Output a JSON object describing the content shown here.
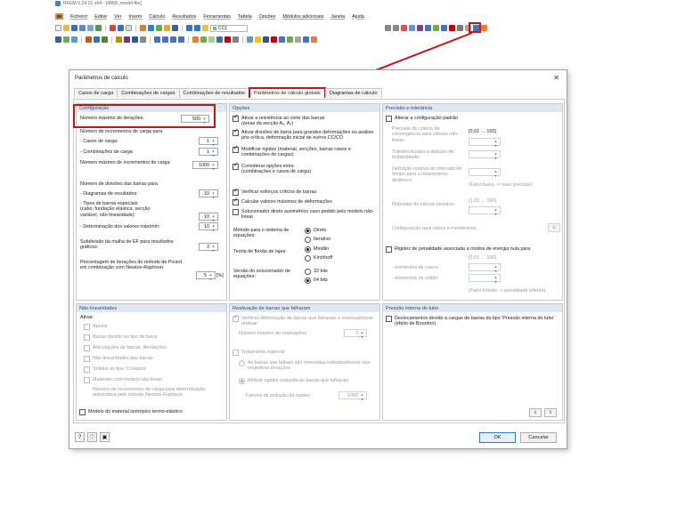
{
  "app": {
    "title": "RFEM 5.24.01 x64 - [4868_model-file]",
    "menu": [
      "Ficheiro",
      "Editar",
      "Ver",
      "Inserir",
      "Cálculo",
      "Resultados",
      "Ferramentas",
      "Tabela",
      "Opções",
      "Módulos adicionais",
      "Janela",
      "Ajuda"
    ],
    "load_case": "CC1"
  },
  "dialog": {
    "title": "Parâmetros de cálculo",
    "close": "✕",
    "tabs": [
      "Casos de carga",
      "Combinações de cargas",
      "Combinações de resultados",
      "Parâmetros de cálculo globais",
      "Diagramas de cálculo"
    ],
    "active_tab": 3
  },
  "config": {
    "header": "Configuração",
    "max_iter_label": "Número máximo de iterações:",
    "max_iter_value": "500",
    "load_increments_header": "Número de incrementos de carga para",
    "lc_label": "- Casos de carga:",
    "lc_value": "1",
    "comb_label": "- Combinações de carga",
    "comb_value": "1",
    "max_load_inc_label": "Número máximo de incrementos de carga:",
    "max_load_inc_value": "1000",
    "bar_div_header": "Número de divisões das barras para",
    "result_diag_label": "- Diagramas de resultados:",
    "result_diag_value": "10",
    "special_bars_label": "- Tipos de barras especiais\n  (cabo, fundação elástica, secção\n  variável, não-linearidade):",
    "special_bars_value": "10",
    "maxmin_label": "- Determinação dos valores máx/mín:",
    "maxmin_value": "10",
    "fe_sub_label": "Subdivisão da malha de EF para resultados gráficos:",
    "fe_sub_value": "3",
    "picard_label": "Percentagem de iterações do método de Picard em combinação com Newton-Raphson:",
    "picard_value": "5",
    "picard_unit": "[%]"
  },
  "options": {
    "header": "Opções",
    "cb1": "Ativar a resistência ao corte das barras\n(áreas da secção Aᵧ, A₂)",
    "cb2": "Ativar divisões de barra para grandes deformações ou análise pós-crítica, deformação inicial de outros CC/CO",
    "cb3": "Modificar rigidez (material, secções, barras casos e combinações de cargas)",
    "cb4": "Considerar opções extra\n(combinações e casos de carga)",
    "cb5": "Verificar esforços críticos de barras",
    "cb6": "Calcular valores máximos de deformações",
    "cb7": "Solucionador direto assimétrico caso pedido pelo modelo não-linear",
    "system_label": "Método para o sistema de equações:",
    "system_opts": [
      "Direto",
      "Iterativo"
    ],
    "plate_label": "Teoria de flexão de lajes:",
    "plate_opts": [
      "Mindlin",
      "Kirchhoff"
    ],
    "solver_label": "Versão do solucionador de equações:",
    "solver_opts": [
      "32 bits",
      "64 bits"
    ]
  },
  "precision": {
    "header": "Precisão e tolerância",
    "change_label": "Alterar a configuração padrão",
    "conv_label": "Precisão do critério de convergência para cálculo não-linear:",
    "range1": "[0,01 … 100]",
    "tol_label": "Tolerância para a deteção de instabilidade:",
    "relax_label": "Definição relativa do intervalo de tempo para o relaxamento dinâmico:",
    "relax_note": "(Fator baixo -> mais precisão)",
    "robust_label": "Robustez do cálculo iterativo:",
    "range2": "[1,00 … 100]",
    "cables_label": "Configuração para cabos e membranas ...",
    "penalty_label": "Rigidez de penalidade associada a modos de energia nula para",
    "range3": "[0,01 … 100]",
    "shell_label": "- elementos de casca:",
    "solid_label": "- elementos de sólido:",
    "penalty_note": "(Fator inferior -> penalidade inferior)"
  },
  "nonlinear": {
    "header": "Não-linearidades",
    "activate": "Ativar:",
    "items": [
      "Apoios",
      "Barras devido ao tipo de barra",
      "Articulações de barras, libertações",
      "Não-linearidades das barras",
      "Sólidos do tipo 'Contacto'",
      "Materiais com modelo não-linear"
    ],
    "mat_inc": "Número de incrementos de carga para determinação automática pelo método Newton-Raphson",
    "iso": "Modelo do material isotrópico termo-elástico"
  },
  "reactivation": {
    "header": "Reativação de barras que falharam",
    "verify": "Verificar deformação de barras que falharam e eventualmente reativar",
    "max_label": "Número máximo de reativações:",
    "max_value": "3",
    "special": "Tratamento especial",
    "opt1": "As barras que falham são removidas individualmente nas respetivas iterações",
    "opt2": "Atribuir rigidez reduzida às barras que falharam",
    "factor_label": "Fatores de redução da rigidez:",
    "factor_value": "1000"
  },
  "pipe": {
    "header": "Pressão interna do tubo",
    "cb": "Deslocamentos devido a cargas de barras do tipo 'Pressão interna do tubo' (efeito de Bourdon)"
  },
  "footer": {
    "ok": "OK",
    "cancel": "Cancelar"
  }
}
